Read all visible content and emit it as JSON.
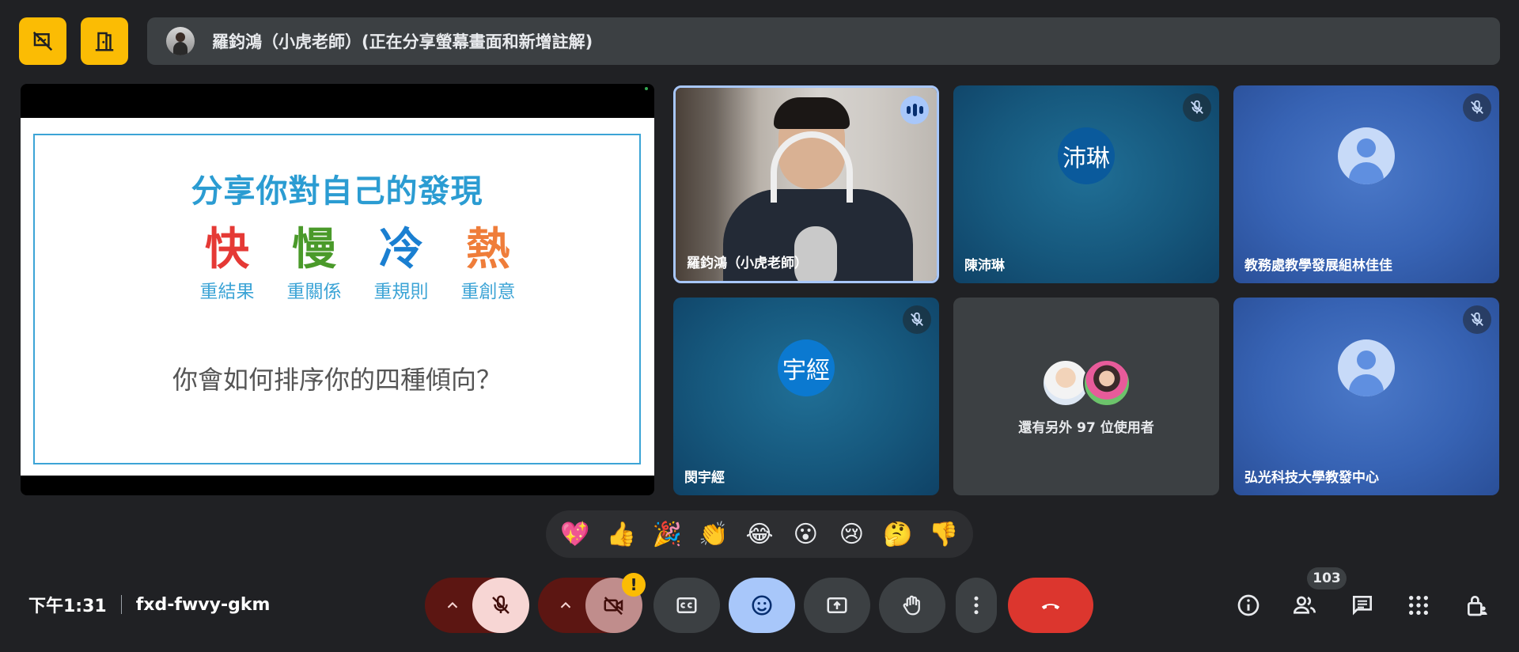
{
  "top_bar": {
    "hide_annotations_icon": "hide-annotations-icon",
    "leave_icon": "leave-icon",
    "presenter_text": "羅鈞鴻（小虎老師）(正在分享螢幕畫面和新增註解)"
  },
  "slide": {
    "title": "分享你對自己的發現",
    "traits": [
      {
        "big": "快",
        "small": "重結果",
        "color": "#e53935"
      },
      {
        "big": "慢",
        "small": "重關係",
        "color": "#4a9a2a"
      },
      {
        "big": "冷",
        "small": "重規則",
        "color": "#1a7fd1"
      },
      {
        "big": "熱",
        "small": "重創意",
        "color": "#ef7d3a"
      }
    ],
    "question": "你會如何排序你的四種傾向？"
  },
  "tiles": {
    "speaker": {
      "name": "羅鈞鴻（小虎老師）"
    },
    "t2": {
      "name": "陳沛琳",
      "initials": "沛琳"
    },
    "t3": {
      "name": "教務處教學發展組林佳佳"
    },
    "t4": {
      "name": "閔宇經",
      "initials": "宇經"
    },
    "others": {
      "text": "還有另外 97 位使用者"
    },
    "t6": {
      "name": "弘光科技大學教發中心"
    }
  },
  "reactions": [
    "💖",
    "👍",
    "🎉",
    "👏",
    "😂",
    "😮",
    "😢",
    "🤔",
    "👎"
  ],
  "bottom": {
    "time": "下午1:31",
    "meeting_code": "fxd-fwvy-gkm",
    "people_count": "103",
    "warning": "!"
  },
  "colors": {
    "accent_yellow": "#fbbc04",
    "end_call_red": "#dc362e",
    "active_blue": "#a8c7fa"
  }
}
